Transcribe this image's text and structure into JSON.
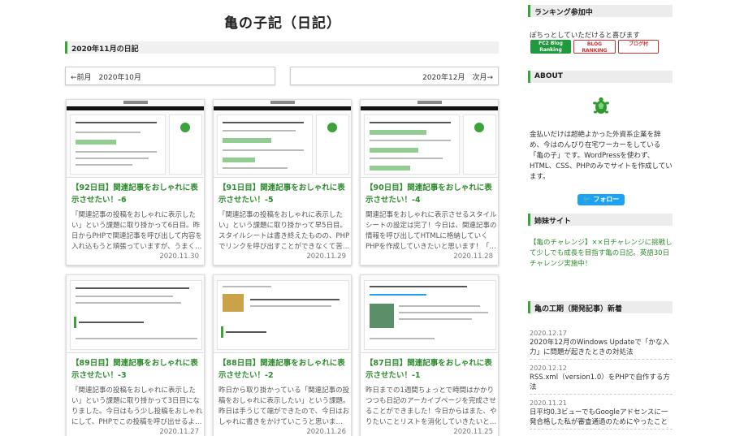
{
  "site": {
    "title": "亀の子記（日記）"
  },
  "month_heading": "2020年11月の日記",
  "nav": {
    "prev": "←前月　2020年10月",
    "next": "2020年12月　次月→"
  },
  "cards": [
    {
      "title": "【92日目】関連記事をおしゃれに表示させたい！-6",
      "excerpt": "「関連記事の投稿をおしゃれに表示したい」という課題に取り掛かって6日目。昨日からPHPで関連記事を呼び出して内容を入れ込もうと頑張っていますが、うまく…",
      "date": "2020.11.30"
    },
    {
      "title": "【91日目】関連記事をおしゃれに表示させたい！-5",
      "excerpt": "「関連記事の投稿をおしゃれに表示したい」という課題に取り掛かって早5日目。スタイルシートは書き終えたものの、PHPでリンクを呼び出すことができなくて苦…",
      "date": "2020.11.29"
    },
    {
      "title": "【90日目】関連記事をおしゃれに表示させたい！-4",
      "excerpt": "関連記事をおしゃれに表示させるスタイルシートの設定は完了！今日は、関連記事の情報を呼び出してHTMLに格納していくPHPを作成していきたいと思います！「…",
      "date": "2020.11.28"
    },
    {
      "title": "【89日目】関連記事をおしゃれに表示させたい！-3",
      "excerpt": "「関連記事の投稿をおしゃれに表示したい」という課題に取り掛かって3日目になりました。今日はもう少し投稿をおしゃれにして、PHPでこの投稿を呼び出せるよ…",
      "date": "2020.11.27"
    },
    {
      "title": "【88日目】関連記事をおしゃれに表示させたい！-2",
      "excerpt": "昨日から取り掛かっている「関連記事の投稿をおしゃれに表示したい」という課題。昨日は手うじて端ができたので、今日はおしゃれに書きをかけていこうと思いま…",
      "date": "2020.11.26"
    },
    {
      "title": "【87日目】関連記事をおしゃれに表示させたい！-1",
      "excerpt": "昨日までの1週間ちょっとで時間はかかりつつも日記のアーカイブページを完成させることができました！今日からはまた、やりたいことリストを消化していきたいと…",
      "date": "2020.11.25"
    }
  ],
  "sidebar": {
    "ranking": {
      "heading": "ランキング参加中",
      "text": "ぽちっとしていただけると喜びます",
      "banners": [
        "FC2 Blog Ranking",
        "BLOG RANKING",
        "ブログ村"
      ]
    },
    "about": {
      "heading": "ABOUT",
      "text": "金払いだけは超絶よかった外資系企業を辞め、今はのんびり在宅ワーカーをしている「亀の子」です。WordPressを使わず、HTML、CSS、PHPのみでサイトを作成しています。",
      "follow": "フォロー"
    },
    "sister": {
      "heading": "姉妹サイト",
      "link": "【亀のチャレンジ】××日チャレンジに挑戦して少しでも成長を目指す亀の日記。英語30日チャレンジ実施中！"
    },
    "posts": {
      "heading": "亀の工期（開発記事）新着",
      "items": [
        {
          "date": "2020.12.17",
          "title": "2020年12月のWindows Updateで「かな入力」に問題が起きたときの対処法"
        },
        {
          "date": "2020.12.12",
          "title": "RSS.xml（version1.0）をPHPで自作する方法"
        },
        {
          "date": "2020.11.21",
          "title": "日平均0.3ビューでもGoogleアドセンスに一発合格した私が審査通過のためにやったこと"
        }
      ]
    }
  },
  "colors": {
    "accent": "#3aa33a",
    "link": "#2e8b2e",
    "twitter": "#1da1f2"
  },
  "icons": [
    "turtle-icon",
    "twitter-bird-icon"
  ]
}
